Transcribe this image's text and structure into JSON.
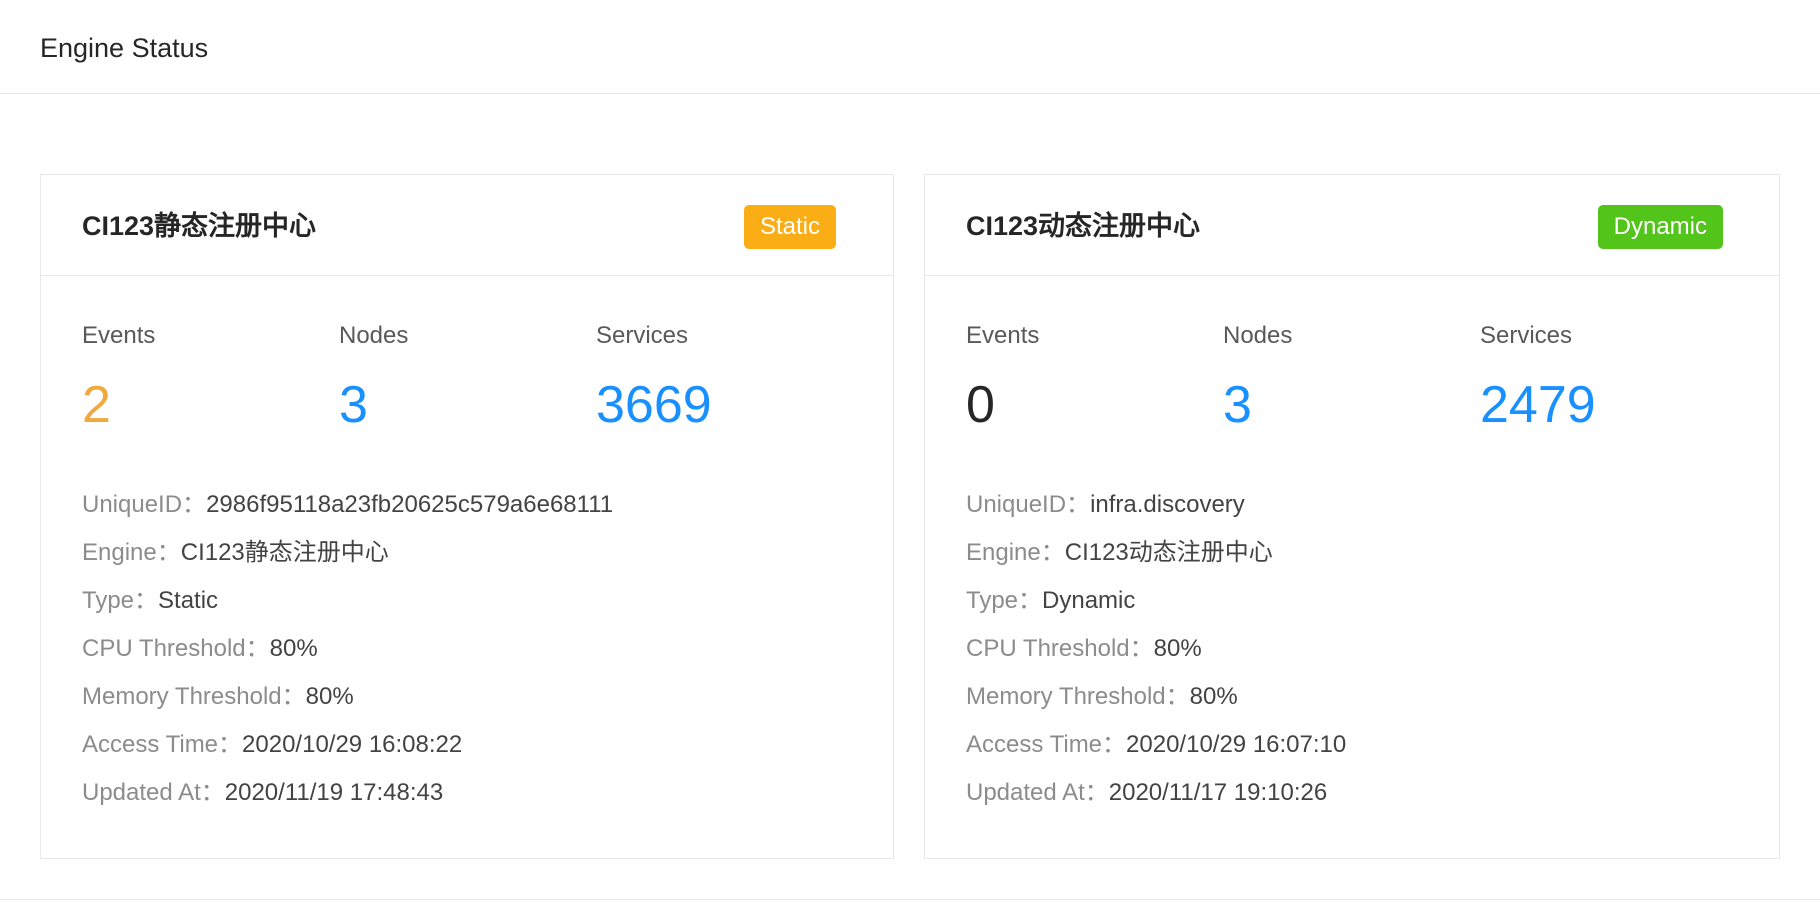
{
  "header": {
    "title": "Engine Status"
  },
  "colors": {
    "static_tag": "#faad14",
    "dynamic_tag": "#52c41a",
    "events_warn": "#f0a93c",
    "events_zero": "#262626",
    "stat_blue": "#1890ff"
  },
  "cards": [
    {
      "title": "CI123静态注册中心",
      "tag": "Static",
      "tag_color": "#faad14",
      "stats": [
        {
          "label": "Events",
          "value": "2",
          "color": "#f0a93c"
        },
        {
          "label": "Nodes",
          "value": "3",
          "color": "#1890ff"
        },
        {
          "label": "Services",
          "value": "3669",
          "color": "#1890ff"
        }
      ],
      "info": [
        {
          "label": "UniqueID：",
          "value": "2986f95118a23fb20625c579a6e68111"
        },
        {
          "label": "Engine：",
          "value": "CI123静态注册中心"
        },
        {
          "label": "Type：",
          "value": "Static"
        },
        {
          "label": "CPU Threshold：",
          "value": "80%"
        },
        {
          "label": "Memory Threshold：",
          "value": "80%"
        },
        {
          "label": "Access Time：",
          "value": "2020/10/29 16:08:22"
        },
        {
          "label": "Updated At：",
          "value": "2020/11/19 17:48:43"
        }
      ]
    },
    {
      "title": "CI123动态注册中心",
      "tag": "Dynamic",
      "tag_color": "#52c41a",
      "stats": [
        {
          "label": "Events",
          "value": "0",
          "color": "#262626"
        },
        {
          "label": "Nodes",
          "value": "3",
          "color": "#1890ff"
        },
        {
          "label": "Services",
          "value": "2479",
          "color": "#1890ff"
        }
      ],
      "info": [
        {
          "label": "UniqueID：",
          "value": "infra.discovery"
        },
        {
          "label": "Engine：",
          "value": "CI123动态注册中心"
        },
        {
          "label": "Type：",
          "value": "Dynamic"
        },
        {
          "label": "CPU Threshold：",
          "value": "80%"
        },
        {
          "label": "Memory Threshold：",
          "value": "80%"
        },
        {
          "label": "Access Time：",
          "value": "2020/10/29 16:07:10"
        },
        {
          "label": "Updated At：",
          "value": "2020/11/17 19:10:26"
        }
      ]
    }
  ]
}
